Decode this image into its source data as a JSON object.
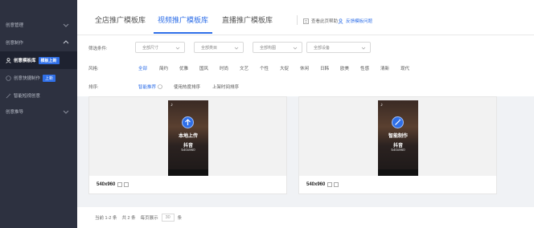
{
  "sidebar": {
    "items": [
      {
        "label": "创意管理"
      },
      {
        "label": "创意制作"
      },
      {
        "label": "创意模板库",
        "badge": "模板上新"
      },
      {
        "label": "创意快捷制作",
        "badge": "上新"
      },
      {
        "label": "智能短视创意"
      },
      {
        "label": "创意推导"
      }
    ]
  },
  "tabs": [
    {
      "label": "全店推广模板库"
    },
    {
      "label": "视频推广模板库"
    },
    {
      "label": "直播推广模板库"
    }
  ],
  "links": {
    "help": "查看此页帮助",
    "feedback": "反馈模板问题"
  },
  "filters": {
    "label": "筛选条件:",
    "selects": [
      "全部尺寸",
      "全部类目",
      "全部构图",
      "全部设备"
    ]
  },
  "style": {
    "label": "风格:",
    "options": [
      "全部",
      "简约",
      "优雅",
      "国风",
      "时尚",
      "文艺",
      "个性",
      "大促",
      "休闲",
      "日韩",
      "欧美",
      "性感",
      "清新",
      "现代"
    ]
  },
  "sort": {
    "label": "排序:",
    "options": [
      "智能推荐",
      "使用热度排序",
      "上架时间排序"
    ]
  },
  "cards": [
    {
      "title": "本地上传",
      "subtitle": "抖音",
      "size_text": "540x960",
      "footer": "540x960",
      "icon": "upload-arrow-icon"
    },
    {
      "title": "智能制作",
      "subtitle": "抖音",
      "size_text": "540x960",
      "footer": "540x960",
      "icon": "magic-wand-icon"
    }
  ],
  "pager": {
    "current": "当前 1-2 条",
    "total": "共 2 条",
    "per_page_label": "每页展示",
    "per_page": "30",
    "unit": "条"
  },
  "colors": {
    "accent": "#2f6fe8",
    "sidebar": "#2d3140"
  }
}
